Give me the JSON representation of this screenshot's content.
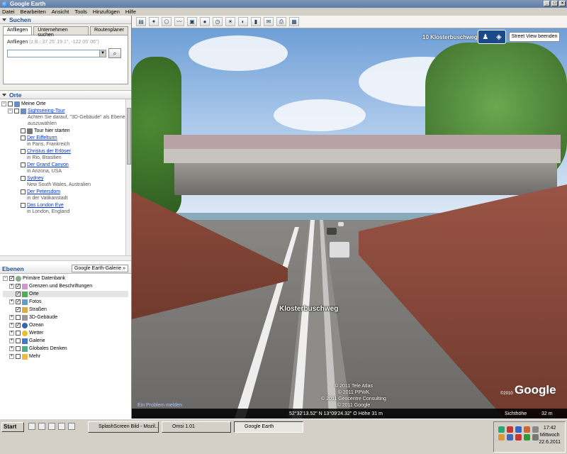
{
  "window": {
    "title": "Google Earth"
  },
  "menu": [
    "Datei",
    "Bearbeiten",
    "Ansicht",
    "Tools",
    "Hinzufügen",
    "Hilfe"
  ],
  "search": {
    "header": "Suchen",
    "tabs": [
      "Anfliegen",
      "Unternehmen suchen",
      "Routenplaner"
    ],
    "hint_label": "Anfliegen",
    "hint_example": "(z.B.: 37 25' 19.1\", -122 05' 06\")",
    "input_value": "",
    "button_icon": "search-icon"
  },
  "places": {
    "header": "Orte",
    "root": "Meine Orte",
    "tour": {
      "title": "Sightseeing-Tour",
      "note": "Achten Sie darauf, \"3D-Gebäude\" als Ebene auszuwählen",
      "start": "Tour hier starten"
    },
    "items": [
      {
        "name": "Der Eiffelturm",
        "loc": "in Paris, Frankreich"
      },
      {
        "name": "Christus der Erlöser",
        "loc": "in Rio, Brasilien"
      },
      {
        "name": "Der Grand Canyon",
        "loc": "in Arizona, USA"
      },
      {
        "name": "Sydney",
        "loc": "New South Wales, Australien"
      },
      {
        "name": "Der Petersdom",
        "loc": "in der Vatikanstadt"
      },
      {
        "name": "Das London Eye",
        "loc": "in London, England"
      }
    ]
  },
  "layers": {
    "header": "Ebenen",
    "gallery_button": "Google Earth-Galerie »",
    "items": [
      {
        "label": "Primäre Datenbank",
        "checked": true,
        "indent": 0
      },
      {
        "label": "Grenzen und Beschriftungen",
        "checked": true,
        "indent": 1
      },
      {
        "label": "Orte",
        "checked": true,
        "indent": 1
      },
      {
        "label": "Fotos",
        "checked": true,
        "indent": 1
      },
      {
        "label": "Straßen",
        "checked": true,
        "indent": 1
      },
      {
        "label": "3D-Gebäude",
        "checked": false,
        "indent": 1
      },
      {
        "label": "Ozean",
        "checked": true,
        "indent": 1
      },
      {
        "label": "Wetter",
        "checked": false,
        "indent": 1
      },
      {
        "label": "Galerie",
        "checked": false,
        "indent": 1
      },
      {
        "label": "Globales Denken",
        "checked": false,
        "indent": 1
      },
      {
        "label": "Mehr",
        "checked": false,
        "indent": 1
      }
    ]
  },
  "view": {
    "top_street": "10 Klosterbuschweg",
    "street_label": "Klosterbuschweg",
    "exit_streetview": "Street View beenden",
    "copyright": [
      "© 2011 Tele Atlas",
      "© 2011 PPWK",
      "© 2011 Geocentre Consulting",
      "© 2011 Google"
    ],
    "problem_link": "Ein Problem melden",
    "logo": "Google",
    "year": "©2010",
    "status": {
      "coords": "52°32'13.52\" N  13°09'24.32\" O  Höhe   31 m",
      "eye_label": "Sichthöhe",
      "eye_value": "32 m"
    }
  },
  "taskbar": {
    "start": "Start",
    "tasks": [
      "SplashScreen Bild - Mozil...",
      "Omsi 1.01",
      "Google Earth"
    ],
    "clock": {
      "time": "17:42",
      "day": "Mittwoch",
      "date": "22.6.2011"
    }
  }
}
